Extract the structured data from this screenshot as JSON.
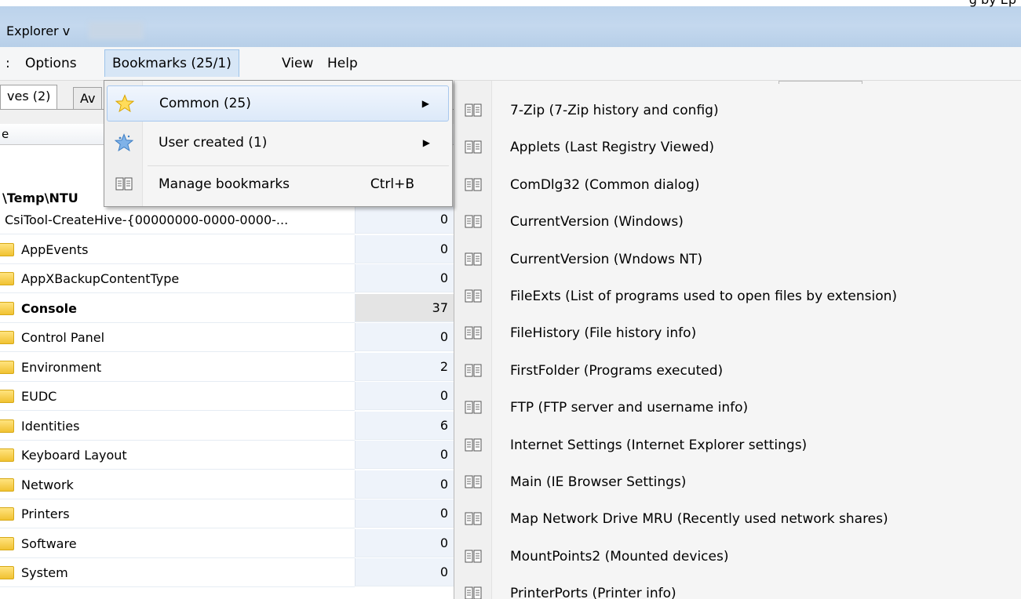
{
  "window": {
    "title": "Explorer v",
    "title_right": "g by Ep"
  },
  "menubar": {
    "items": [
      ":",
      "Options",
      "Bookmarks (25/1)",
      "View",
      "Help"
    ]
  },
  "tabs": [
    "ves (2)",
    "Av"
  ],
  "column_header": "e",
  "path": "\\Temp\\NTU",
  "tree": [
    {
      "label": "CsiTool-CreateHive-{00000000-0000-0000-...",
      "count": "0",
      "root": true
    },
    {
      "label": "AppEvents",
      "count": "0"
    },
    {
      "label": "AppXBackupContentType",
      "count": "0"
    },
    {
      "label": "Console",
      "count": "37",
      "selected": true
    },
    {
      "label": "Control Panel",
      "count": "0"
    },
    {
      "label": "Environment",
      "count": "2"
    },
    {
      "label": "EUDC",
      "count": "0"
    },
    {
      "label": "Identities",
      "count": "6"
    },
    {
      "label": "Keyboard Layout",
      "count": "0"
    },
    {
      "label": "Network",
      "count": "0"
    },
    {
      "label": "Printers",
      "count": "0"
    },
    {
      "label": "Software",
      "count": "0"
    },
    {
      "label": "System",
      "count": "0"
    }
  ],
  "bookmarks_menu": {
    "items": [
      {
        "label": "Common (25)",
        "icon": "star-icon",
        "has_submenu": true
      },
      {
        "label": "User created (1)",
        "icon": "blue-star-icon",
        "has_submenu": true
      },
      {
        "label": "Manage bookmarks",
        "icon": "book-icon",
        "shortcut": "Ctrl+B"
      }
    ]
  },
  "common_submenu": {
    "items": [
      "7-Zip (7-Zip history and config)",
      "Applets (Last Registry Viewed)",
      "ComDlg32 (Common dialog)",
      "CurrentVersion (Windows)",
      "CurrentVersion (Wndows NT)",
      "FileExts (List of programs used to open files by extension)",
      "FileHistory (File history info)",
      "FirstFolder (Programs executed)",
      "FTP (FTP server and username info)",
      "Internet Settings (Internet Explorer settings)",
      "Main (IE Browser Settings)",
      "Map Network Drive MRU (Recently used network shares)",
      "MountPoints2 (Mounted devices)",
      "PrinterPorts (Printer info)"
    ]
  },
  "colors": {
    "titlebar": "#c4d8ee",
    "menu_highlight": "#dce9f9",
    "folder": "#f1c232"
  }
}
